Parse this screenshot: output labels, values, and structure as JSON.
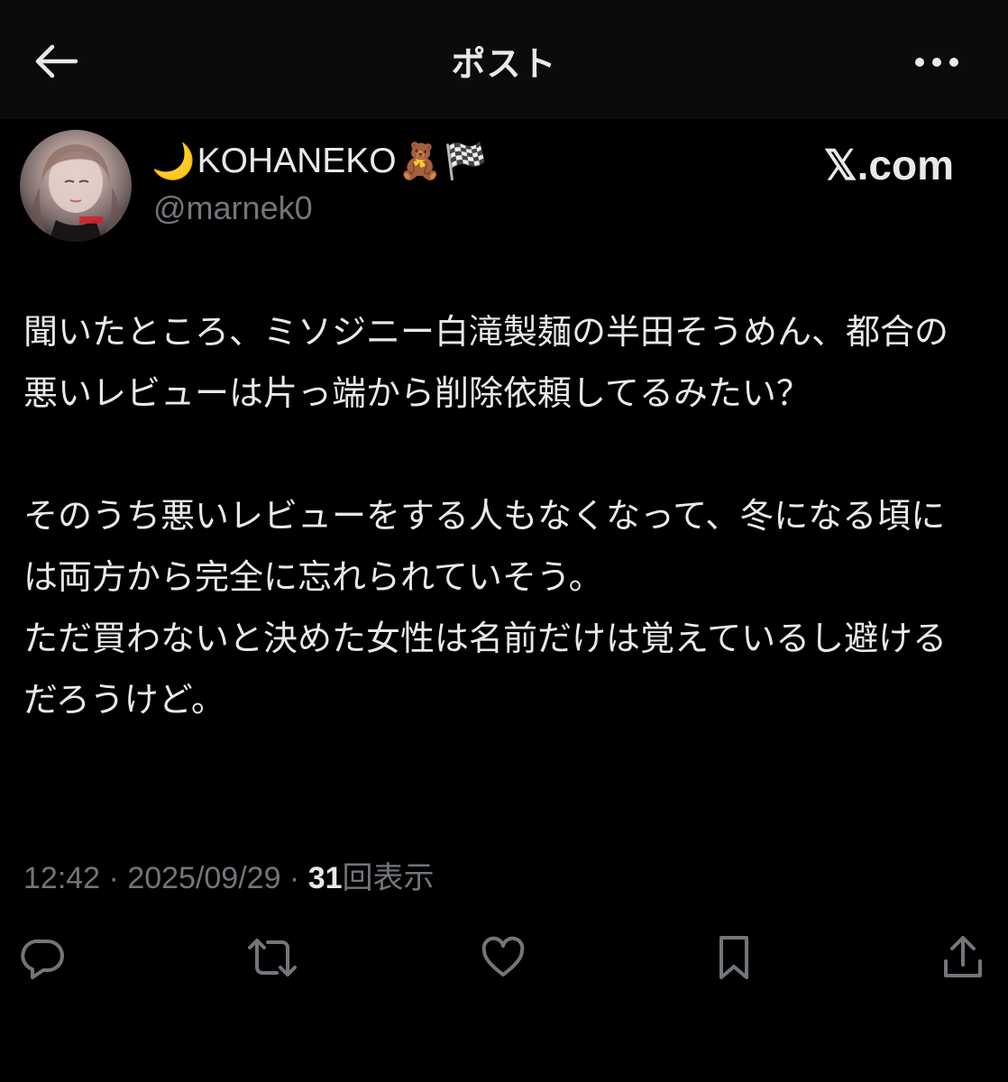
{
  "header": {
    "title": "ポスト"
  },
  "author": {
    "display_name": "KOHANEKO",
    "name_prefix_emoji": "🌙",
    "name_suffix_emoji": "🧸",
    "name_flag_emoji": "🏁",
    "handle": "@marnek0"
  },
  "brand": {
    "x_glyph": "𝕏",
    "label": ".com"
  },
  "post": {
    "paragraph1": "聞いたところ、ミソジニー白滝製麺の半田そうめん、都合の悪いレビューは片っ端から削除依頼してるみたい？",
    "paragraph2_line1": "そのうち悪いレビューをする人もなくなって、冬になる頃には両方から完全に忘れられていそう。",
    "paragraph2_line2": "ただ買わないと決めた女性は名前だけは覚えているし避けるだろうけど。"
  },
  "meta": {
    "time": "12:42",
    "separator": " · ",
    "date": "2025/09/29",
    "views_count": "31",
    "views_label": "回表示"
  },
  "actions": {
    "icons": [
      "reply-icon",
      "repost-icon",
      "like-icon",
      "bookmark-icon",
      "share-icon"
    ]
  },
  "colors": {
    "background": "#000000",
    "header_background": "#0b0b0b",
    "text": "#e7e9ea",
    "secondary_text": "#71767b"
  }
}
